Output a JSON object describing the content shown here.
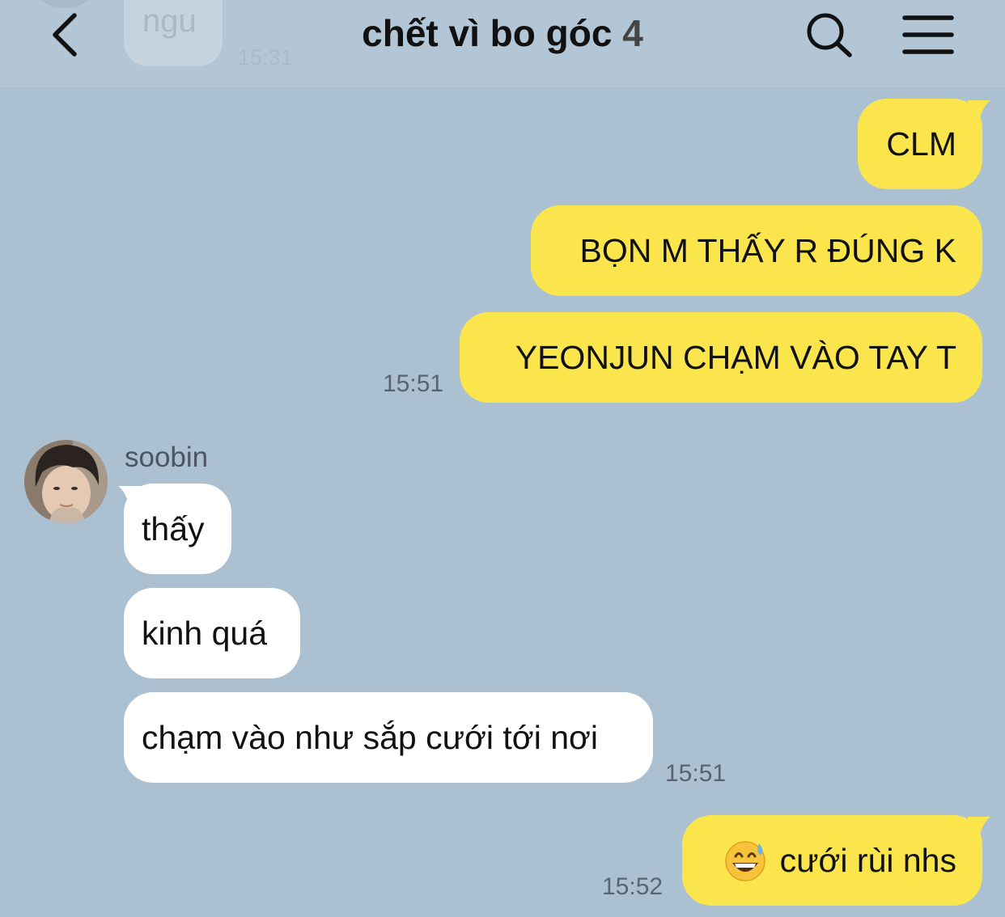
{
  "header": {
    "title": "chết vì bo góc",
    "member_count": "4",
    "back_icon": "chevron-left-icon",
    "search_icon": "search-icon",
    "menu_icon": "hamburger-menu-icon"
  },
  "previous_message": {
    "text": "ngu",
    "time": "15:31"
  },
  "messages": [
    {
      "direction": "out",
      "text": "CLM"
    },
    {
      "direction": "out",
      "text": "BỌN M THẤY R ĐÚNG K"
    },
    {
      "direction": "out",
      "text": "YEONJUN CHẠM VÀO TAY T",
      "time": "15:51"
    },
    {
      "direction": "in",
      "sender": "soobin",
      "text": "thấy"
    },
    {
      "direction": "in",
      "text": "kinh quá"
    },
    {
      "direction": "in",
      "text": "chạm vào như sắp cưới tới nơi",
      "time": "15:51"
    },
    {
      "direction": "out",
      "emoji": "grinning-face-with-sweat-emoji",
      "text": "cưới rùi nhs",
      "time": "15:52"
    }
  ],
  "colors": {
    "background": "#abc1d1",
    "outgoing_bubble": "#fae64c",
    "incoming_bubble": "#ffffff"
  }
}
